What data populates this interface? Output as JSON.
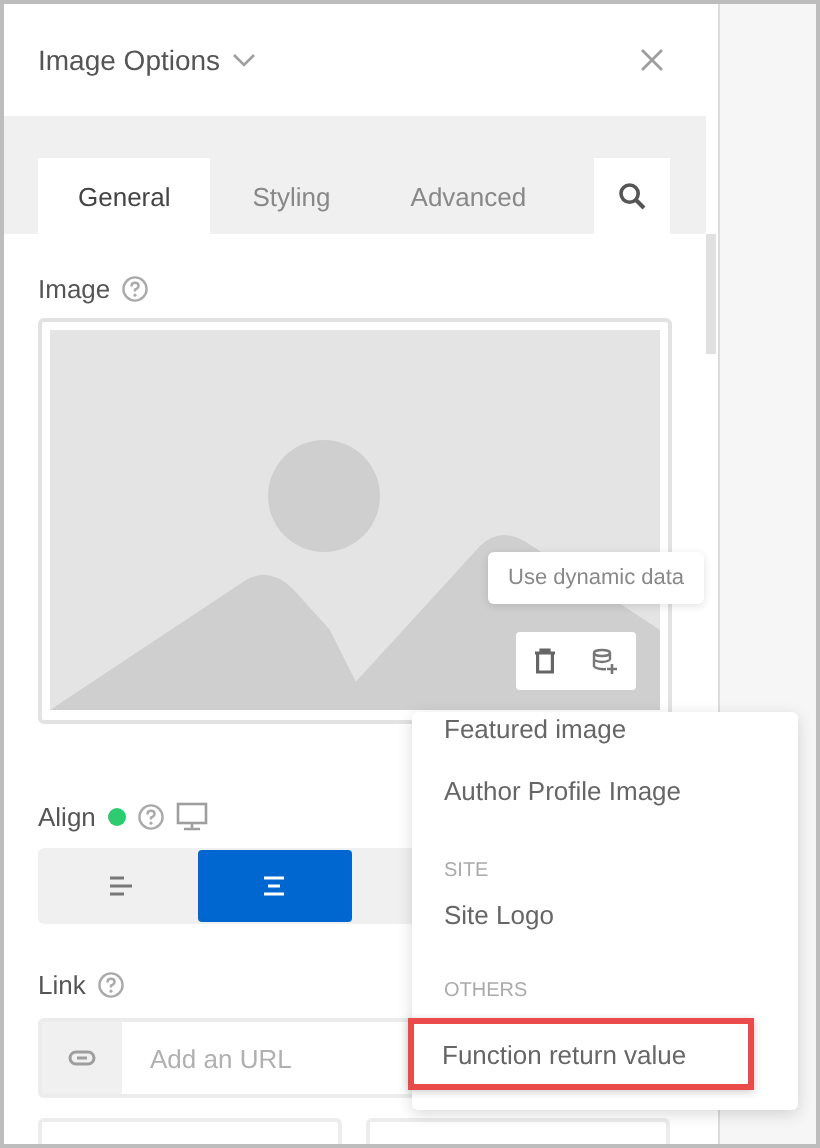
{
  "panel": {
    "title": "Image Options"
  },
  "tabs": [
    {
      "label": "General",
      "selected": true
    },
    {
      "label": "Styling",
      "selected": false
    },
    {
      "label": "Advanced",
      "selected": false
    }
  ],
  "image_field": {
    "label": "Image",
    "tooltip": "Use dynamic data"
  },
  "dynamic_menu": [
    {
      "kind": "item",
      "label": "Featured image",
      "highlighted": false
    },
    {
      "kind": "item",
      "label": "Author Profile Image",
      "highlighted": false
    },
    {
      "kind": "heading",
      "label": "SITE"
    },
    {
      "kind": "item",
      "label": "Site Logo",
      "highlighted": false
    },
    {
      "kind": "heading",
      "label": "OTHERS"
    },
    {
      "kind": "item",
      "label": "Function return value",
      "highlighted": true
    }
  ],
  "align": {
    "label": "Align",
    "options": [
      {
        "kind": "left",
        "selected": false
      },
      {
        "kind": "center",
        "selected": true
      }
    ]
  },
  "link": {
    "label": "Link",
    "placeholder": "Add an URL"
  }
}
